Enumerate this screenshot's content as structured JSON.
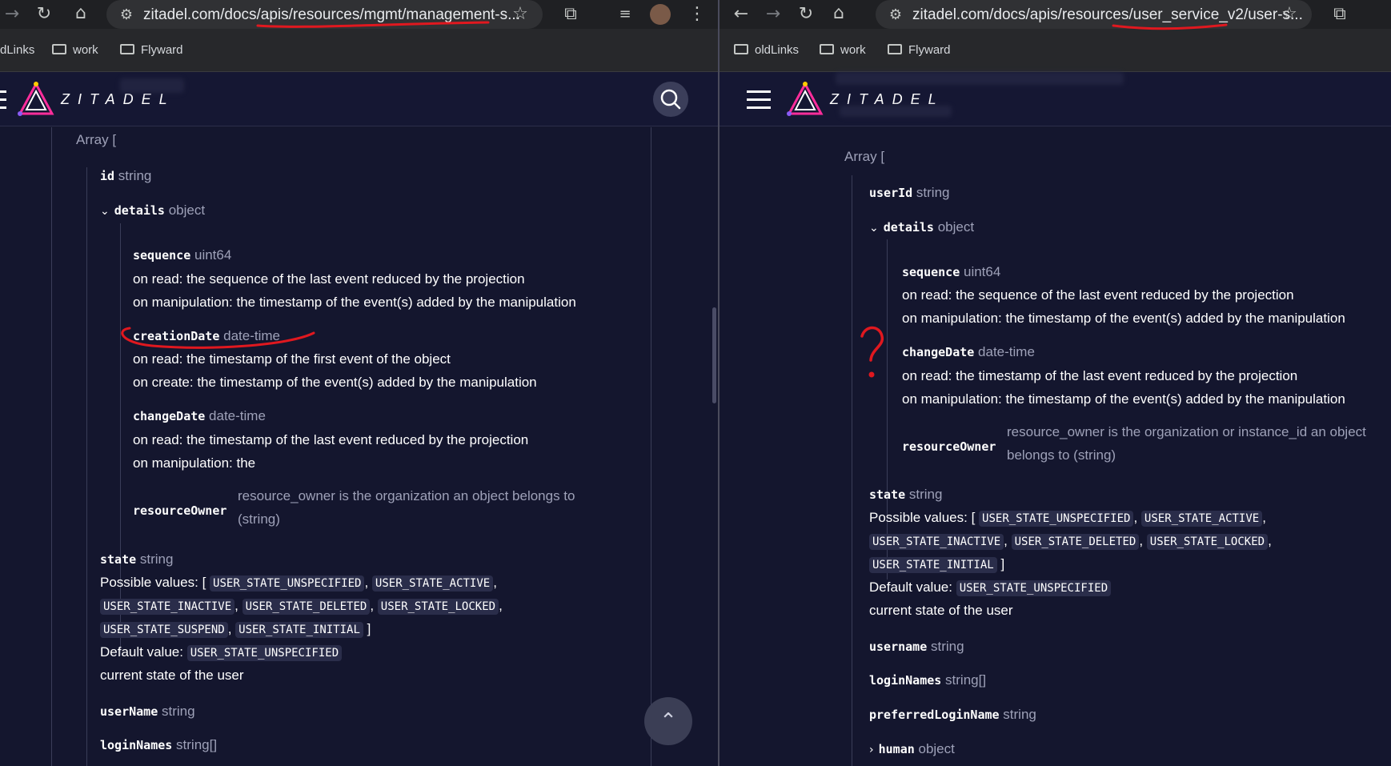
{
  "left": {
    "url": "zitadel.com/docs/apis/resources/mgmt/management-s...",
    "bookmarks": [
      "dLinks",
      "work",
      "Flyward"
    ],
    "logo_text": "ZITADEL",
    "array_open": "Array [",
    "id": {
      "name": "id",
      "type": "string"
    },
    "details": {
      "name": "details",
      "type": "object"
    },
    "sequence": {
      "name": "sequence",
      "type": "uint64",
      "lines": [
        "on read: the sequence of the last event reduced by the projection",
        "on manipulation: the timestamp of the event(s) added by the manipulation"
      ]
    },
    "creationDate": {
      "name": "creationDate",
      "type": "date-time",
      "lines": [
        "on read: the timestamp of the first event of the object",
        "on create: the timestamp of the event(s) added by the manipulation"
      ]
    },
    "changeDate": {
      "name": "changeDate",
      "type": "date-time",
      "lines": [
        "on read: the timestamp of the last event reduced by the projection",
        "on manipulation: the"
      ]
    },
    "resourceOwner": {
      "name": "resourceOwner",
      "lines": [
        "resource_owner is the organization an object belongs to",
        "(string)"
      ]
    },
    "state": {
      "name": "state",
      "type": "string",
      "possible_label": "Possible values: [",
      "values": [
        "USER_STATE_UNSPECIFIED",
        "USER_STATE_ACTIVE",
        "USER_STATE_INACTIVE",
        "USER_STATE_DELETED",
        "USER_STATE_LOCKED",
        "USER_STATE_SUSPEND",
        "USER_STATE_INITIAL"
      ],
      "close": "]",
      "default_label": "Default value:",
      "default_value": "USER_STATE_UNSPECIFIED",
      "desc": "current state of the user"
    },
    "userName": {
      "name": "userName",
      "type": "string"
    },
    "loginNames": {
      "name": "loginNames",
      "type": "string[]"
    }
  },
  "right": {
    "url": "zitadel.com/docs/apis/resources/user_service_v2/user-s...",
    "bookmarks": [
      "oldLinks",
      "work",
      "Flyward"
    ],
    "logo_text": "ZITADEL",
    "array_open": "Array [",
    "userId": {
      "name": "userId",
      "type": "string"
    },
    "details": {
      "name": "details",
      "type": "object"
    },
    "sequence": {
      "name": "sequence",
      "type": "uint64",
      "lines": [
        "on read: the sequence of the last event reduced by the projection",
        "on manipulation: the timestamp of the event(s) added by the manipulation"
      ]
    },
    "changeDate": {
      "name": "changeDate",
      "type": "date-time",
      "lines": [
        "on read: the timestamp of the last event reduced by the projection",
        "on manipulation: the timestamp of the event(s) added by the manipulation"
      ]
    },
    "resourceOwner": {
      "name": "resourceOwner",
      "lines": [
        "resource_owner is the organization or instance_id an object",
        "belongs to (string)"
      ]
    },
    "state": {
      "name": "state",
      "type": "string",
      "possible_label": "Possible values: [",
      "values": [
        "USER_STATE_UNSPECIFIED",
        "USER_STATE_ACTIVE",
        "USER_STATE_INACTIVE",
        "USER_STATE_DELETED",
        "USER_STATE_LOCKED",
        "USER_STATE_INITIAL"
      ],
      "close": "]",
      "default_label": "Default value:",
      "default_value": "USER_STATE_UNSPECIFIED",
      "desc": "current state of the user"
    },
    "username": {
      "name": "username",
      "type": "string"
    },
    "loginNames": {
      "name": "loginNames",
      "type": "string[]"
    },
    "preferredLoginName": {
      "name": "preferredLoginName",
      "type": "string"
    },
    "human": {
      "name": "human",
      "type": "object"
    }
  },
  "annotation_colors": {
    "ink": "#e0181f"
  },
  "accent": {
    "logo_pink": "#ff2d9b",
    "logo_yellow": "#ffcc00",
    "logo_purple": "#8b5cf6"
  }
}
